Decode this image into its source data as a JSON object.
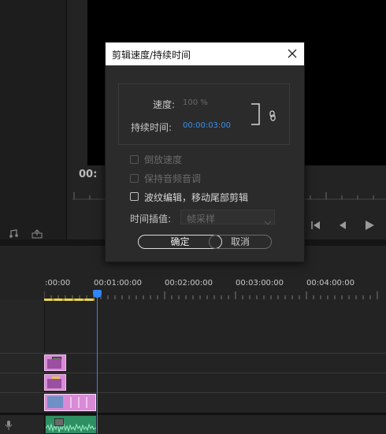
{
  "dialog": {
    "title": "剪辑速度/持续时间",
    "speed_label": "速度:",
    "speed_value": "100 %",
    "duration_label": "持续时间:",
    "duration_value": "00:00:03:00",
    "reverse_label": "倒放速度",
    "maintain_audio_label": "保持音频音调",
    "ripple_label": "波纹编辑，移动尾部剪辑",
    "interp_label": "时间插值:",
    "interp_value": "帧采样",
    "ok_label": "确定",
    "cancel_label": "取消"
  },
  "monitor": {
    "timecode_partial": "00:"
  },
  "timeline": {
    "ruler_labels": [
      ":00:00",
      "00:01:00:00",
      "00:02:00:00",
      "00:03:00:00",
      "00:04:00:00"
    ]
  },
  "colors": {
    "clip_pink": "#d98ad6",
    "clip_blue": "#6f8fc7",
    "audio_green": "#2e8f63",
    "playhead": "#2f86ff",
    "work_area": "#e6d35a",
    "link_duration": "#3b8fe6"
  }
}
